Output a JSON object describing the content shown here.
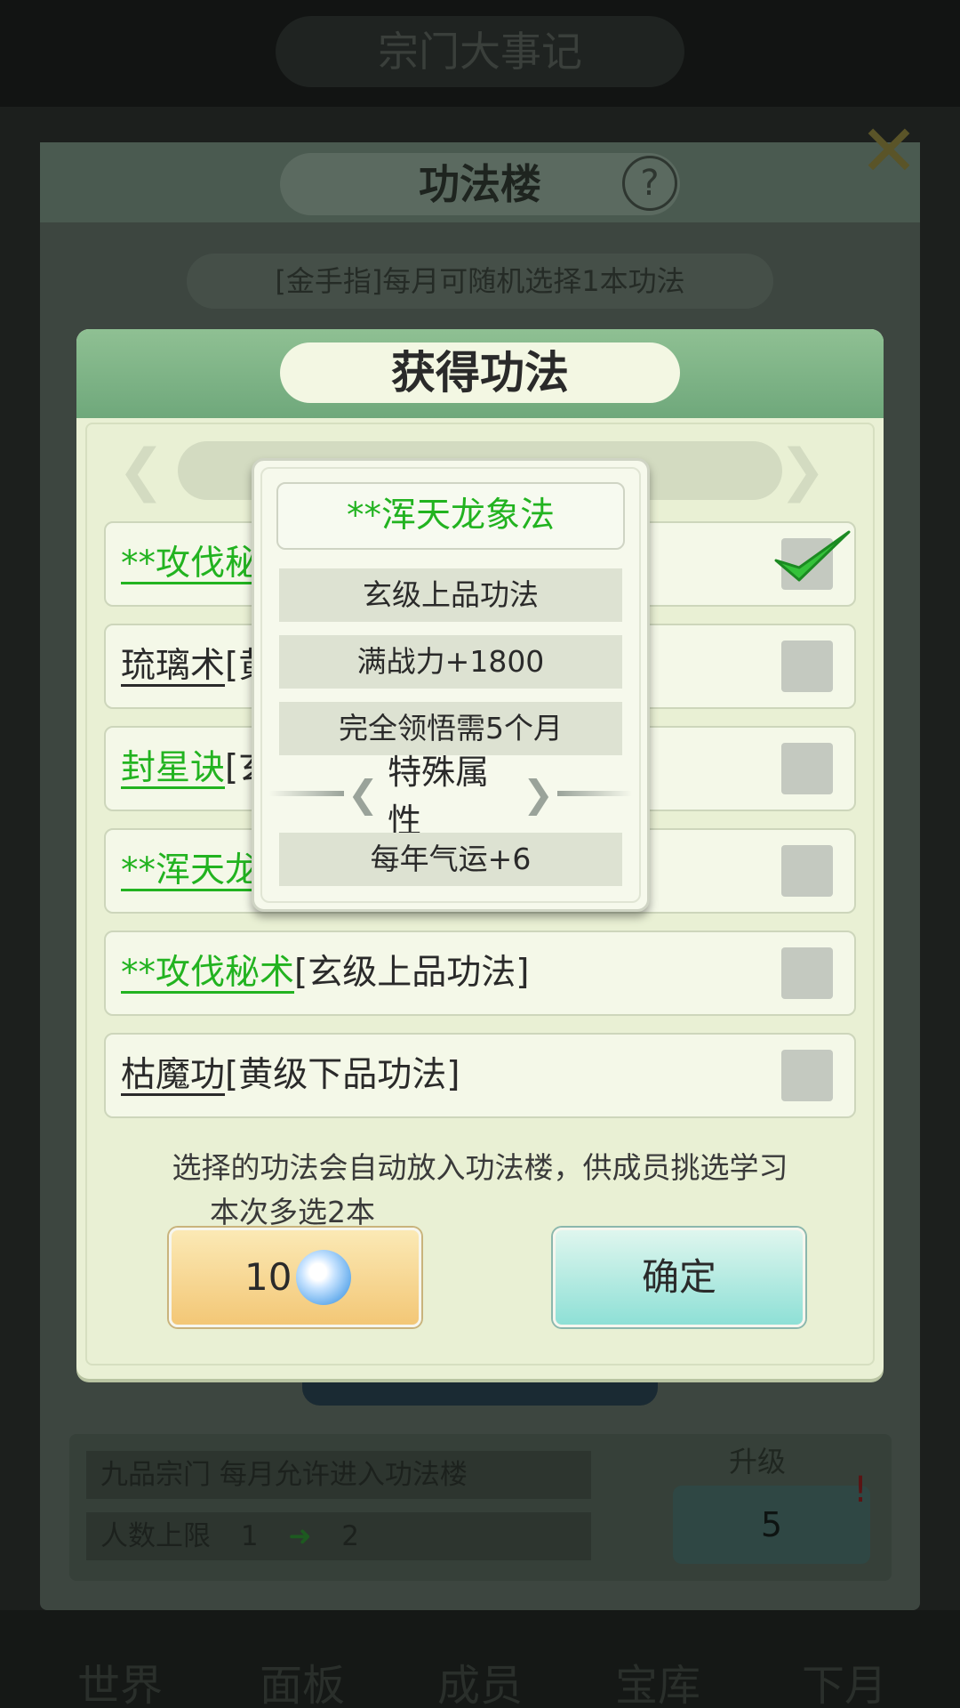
{
  "background": {
    "header_title": "宗门大事记",
    "panel_title": "功法楼",
    "help_icon": "?",
    "banner_text": "[金手指]每月可随机选择1本功法",
    "info": {
      "row1": "九品宗门   每月允许进入功法楼",
      "row2_label": "人数上限",
      "row2_from": "1",
      "row2_to": "2"
    },
    "upgrade_label": "升级",
    "upgrade_cost": "5",
    "nav": [
      "世界",
      "面板",
      "成员",
      "宝库",
      "下月"
    ]
  },
  "dialog": {
    "title": "获得功法",
    "rows": [
      {
        "name": "**攻伐秘",
        "grade": "",
        "color": "green",
        "checked": true
      },
      {
        "name": "琉璃术",
        "grade": "[黄",
        "color": "dark",
        "checked": false
      },
      {
        "name": "封星诀",
        "grade": "[玄",
        "color": "green",
        "checked": false
      },
      {
        "name": "**浑天龙",
        "grade": "",
        "color": "green",
        "checked": false
      },
      {
        "name": "**攻伐秘术",
        "grade": "[玄级上品功法]",
        "color": "green",
        "checked": false
      },
      {
        "name": "枯魔功",
        "grade": "[黄级下品功法]",
        "color": "dark",
        "checked": false
      }
    ],
    "hint": "选择的功法会自动放入功法楼，供成员挑选学习",
    "multi": "本次多选2本",
    "cost_button": {
      "amount": "10",
      "icon": "spirit-stone-icon"
    },
    "confirm_button": "确定"
  },
  "popup": {
    "name": "**浑天龙象法",
    "grade": "玄级上品功法",
    "power": "满战力+1800",
    "comprehend": "完全领悟需5个月",
    "special_title": "特殊属性",
    "special": "每年气运+6"
  },
  "colors": {
    "green_text": "#22b320",
    "dialog_bg": "#e9f0d4",
    "header_green": "#6fa87b",
    "cost_button": "#f3c776",
    "confirm_button": "#8ee0d6"
  }
}
